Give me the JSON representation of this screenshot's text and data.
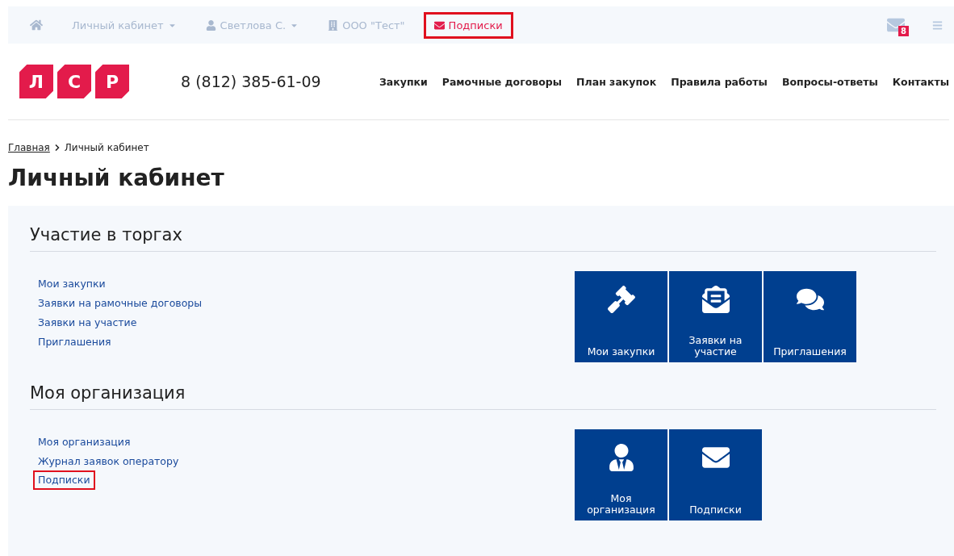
{
  "topbar": {
    "items": [
      {
        "kind": "home",
        "highlighted": false
      },
      {
        "kind": "dropdown",
        "label": "Личный кабинет",
        "highlighted": false
      },
      {
        "kind": "dropdown",
        "label": "Светлова С.",
        "highlighted": false
      },
      {
        "kind": "link",
        "label": "ООО \"Тест\"",
        "highlighted": false
      },
      {
        "kind": "active",
        "label": "Подписки",
        "highlighted": true
      }
    ],
    "mail_badge": "8"
  },
  "header": {
    "logo_letters": [
      "Л",
      "С",
      "Р"
    ],
    "phone": "8 (812) 385-61-09",
    "nav": [
      "Закупки",
      "Рамочные договоры",
      "План закупок",
      "Правила работы",
      "Вопросы-ответы",
      "Контакты"
    ]
  },
  "breadcrumb": {
    "items": [
      "Главная",
      "Личный кабинет"
    ]
  },
  "page_title": "Личный кабинет",
  "sections": [
    {
      "title": "Участие в торгах",
      "links": [
        {
          "label": "Мои закупки",
          "highlighted": false
        },
        {
          "label": "Заявки на рамочные договоры",
          "highlighted": false
        },
        {
          "label": "Заявки на участие",
          "highlighted": false
        },
        {
          "label": "Приглашения",
          "highlighted": false
        }
      ],
      "tiles": [
        {
          "label": "Мои закупки"
        },
        {
          "label": "Заявки на участие"
        },
        {
          "label": "Приглашения"
        }
      ]
    },
    {
      "title": "Моя организация",
      "links": [
        {
          "label": "Моя организация",
          "highlighted": false
        },
        {
          "label": "Журнал заявок оператору",
          "highlighted": false
        },
        {
          "label": "Подписки",
          "highlighted": true
        }
      ],
      "tiles": [
        {
          "label": "Моя организация"
        },
        {
          "label": "Подписки"
        }
      ]
    }
  ]
}
